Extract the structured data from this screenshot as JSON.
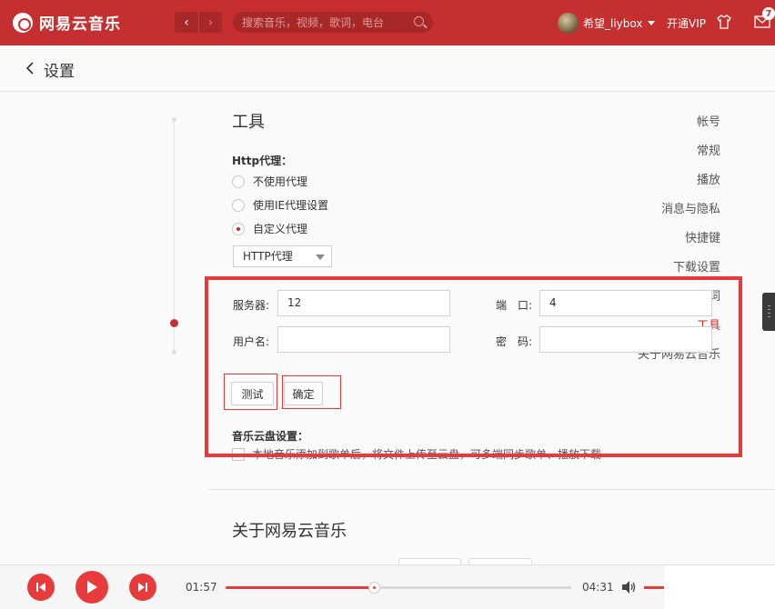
{
  "app": {
    "name": "网易云音乐"
  },
  "topbar": {
    "search_placeholder": "搜索音乐，视频，歌词，电台",
    "username": "希望_liybox",
    "vip": "开通VIP",
    "mail_count": "7",
    "accent": "#c62f2f"
  },
  "header": {
    "title": "设置"
  },
  "sidebar": {
    "items": [
      {
        "label": "帐号"
      },
      {
        "label": "常规"
      },
      {
        "label": "播放"
      },
      {
        "label": "消息与隐私"
      },
      {
        "label": "快捷键"
      },
      {
        "label": "下载设置"
      },
      {
        "label": "歌词"
      },
      {
        "label": "工具",
        "active": true
      },
      {
        "label": "关于网易云音乐"
      }
    ]
  },
  "tools": {
    "title": "工具",
    "proxy_label": "Http代理：",
    "radios": [
      {
        "label": "不使用代理",
        "checked": false
      },
      {
        "label": "使用IE代理设置",
        "checked": false
      },
      {
        "label": "自定义代理",
        "checked": true
      }
    ],
    "proxy_type": "HTTP代理",
    "server_label": "服务器:",
    "server_value": "12",
    "port_label": "端　口:",
    "port_value": "4",
    "username_label": "用户名:",
    "username_value": "",
    "password_label": "密　码:",
    "password_value": "",
    "test_button": "测试",
    "confirm_button": "确定",
    "cloud_label": "音乐云盘设置：",
    "cloud_option": "本地音乐添加到歌单后，将文件上传至云盘，可多端同步歌单、播放下载"
  },
  "about": {
    "title": "关于网易云音乐"
  },
  "player": {
    "current_time": "01:57",
    "total_time": "04:31",
    "progress": 0.43
  }
}
